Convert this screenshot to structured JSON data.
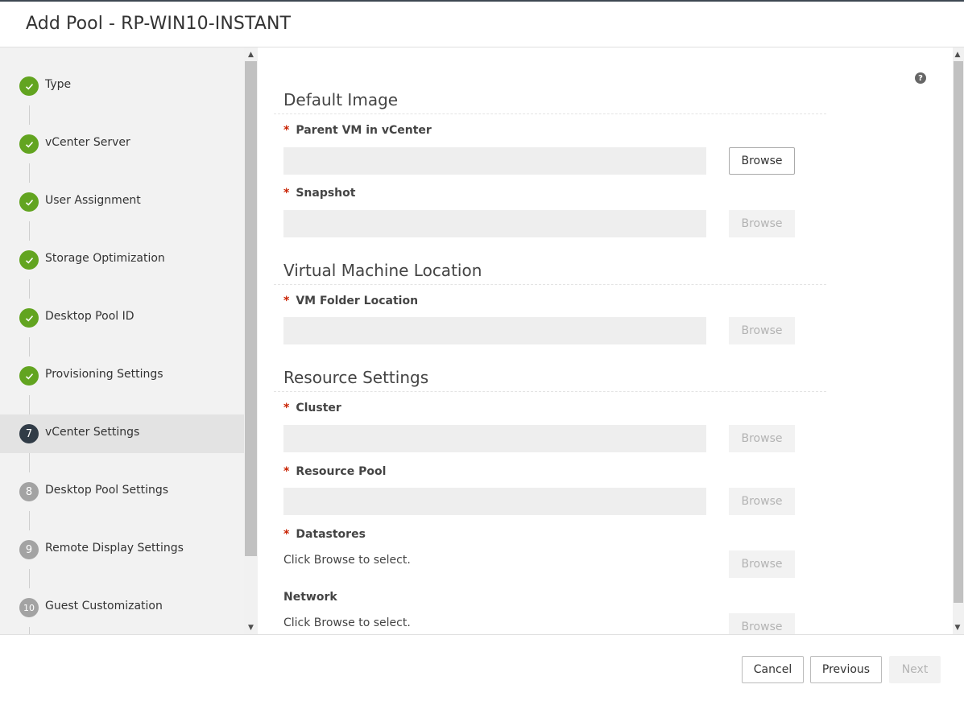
{
  "header": {
    "title": "Add Pool - RP-WIN10-INSTANT"
  },
  "steps": [
    {
      "label": "Type",
      "state": "done",
      "number": "1"
    },
    {
      "label": "vCenter Server",
      "state": "done",
      "number": "2"
    },
    {
      "label": "User Assignment",
      "state": "done",
      "number": "3"
    },
    {
      "label": "Storage Optimization",
      "state": "done",
      "number": "4"
    },
    {
      "label": "Desktop Pool ID",
      "state": "done",
      "number": "5"
    },
    {
      "label": "Provisioning Settings",
      "state": "done",
      "number": "6"
    },
    {
      "label": "vCenter Settings",
      "state": "current",
      "number": "7"
    },
    {
      "label": "Desktop Pool Settings",
      "state": "pending",
      "number": "8"
    },
    {
      "label": "Remote Display Settings",
      "state": "pending",
      "number": "9"
    },
    {
      "label": "Guest Customization",
      "state": "pending",
      "number": "10"
    }
  ],
  "main": {
    "help_icon": "?",
    "sections": {
      "default_image": "Default Image",
      "vm_location": "Virtual Machine Location",
      "resource_settings": "Resource Settings"
    },
    "fields": {
      "parent_vm": {
        "label": "Parent VM in vCenter",
        "required_mark": "*",
        "value": ""
      },
      "snapshot": {
        "label": "Snapshot",
        "required_mark": "*",
        "value": ""
      },
      "vm_folder": {
        "label": "VM Folder Location",
        "required_mark": "*",
        "value": ""
      },
      "cluster": {
        "label": "Cluster",
        "required_mark": "*",
        "value": ""
      },
      "resource_pool": {
        "label": "Resource Pool",
        "required_mark": "*",
        "value": ""
      },
      "datastores": {
        "label": "Datastores",
        "required_mark": "*",
        "hint": "Click Browse to select."
      },
      "network": {
        "label": "Network",
        "hint": "Click Browse to select."
      }
    },
    "browse_label": "Browse"
  },
  "footer": {
    "cancel": "Cancel",
    "previous": "Previous",
    "next": "Next"
  },
  "colors": {
    "done": "#62a420",
    "current": "#313c47",
    "pending": "#a3a3a3",
    "required": "#c92100"
  }
}
